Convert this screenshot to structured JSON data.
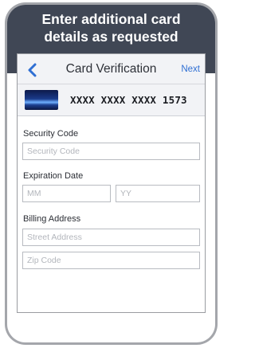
{
  "banner": {
    "title": "Enter additional card\ndetails as requested"
  },
  "navbar": {
    "title": "Card Verification",
    "next_label": "Next",
    "back_icon": "chevron-left-icon"
  },
  "card": {
    "number": "XXXX XXXX XXXX 1573"
  },
  "form": {
    "security_code": {
      "label": "Security Code",
      "placeholder": "Security Code"
    },
    "expiration": {
      "label": "Expiration Date",
      "month_placeholder": "MM",
      "year_placeholder": "YY"
    },
    "billing": {
      "label": "Billing Address",
      "street_placeholder": "Street Address",
      "zip_placeholder": "Zip Code"
    }
  },
  "colors": {
    "banner_bg": "#404755",
    "link_blue": "#2f6fd3",
    "device_frame": "#a4a6ab"
  }
}
